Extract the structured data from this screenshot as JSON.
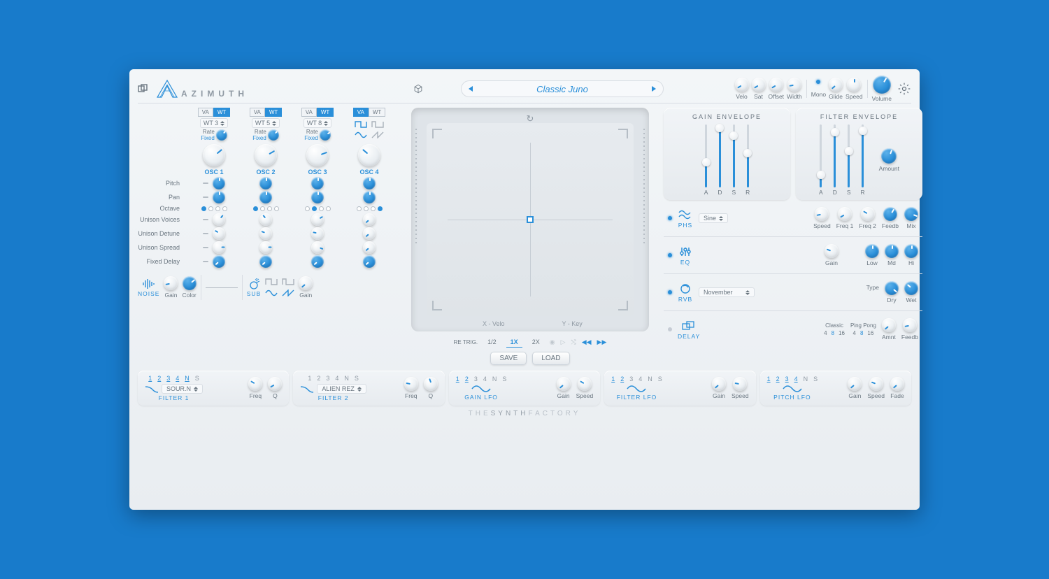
{
  "brand": "AZIMUTH",
  "topknobs": {
    "velo": "Velo",
    "sat": "Sat",
    "offset": "Offset",
    "width": "Width",
    "mono": "Mono",
    "glide": "Glide",
    "speed": "Speed",
    "volume": "Volume"
  },
  "preset": {
    "name": "Classic Juno"
  },
  "osc": {
    "tab_va": "VA",
    "tab_wt": "WT",
    "wt": [
      "WT 3",
      "WT 5",
      "WT 8"
    ],
    "rate": "Rate",
    "fixed": "Fixed",
    "labels": [
      "OSC 1",
      "OSC 2",
      "OSC 3",
      "OSC 4"
    ],
    "rows": {
      "pitch": "Pitch",
      "pan": "Pan",
      "octave": "Octave",
      "uvoices": "Unison Voices",
      "udetune": "Unison Detune",
      "uspread": "Unison Spread",
      "fdelay": "Fixed Delay"
    }
  },
  "noise": {
    "label": "NOISE",
    "gain": "Gain",
    "color": "Color"
  },
  "sub": {
    "label": "SUB",
    "gain": "Gain"
  },
  "xy": {
    "x": "X - Velo",
    "y": "Y - Key",
    "retrig": "RE TRIG.",
    "half": "1/2",
    "one": "1X",
    "two": "2X",
    "save": "SAVE",
    "load": "LOAD"
  },
  "env": {
    "gain_title": "GAIN ENVELOPE",
    "filter_title": "FILTER ENVELOPE",
    "a": "A",
    "d": "D",
    "s": "S",
    "r": "R",
    "amount": "Amount",
    "gain_vals": {
      "a": 40,
      "d": 95,
      "s": 82,
      "r": 55
    },
    "filter_vals": {
      "a": 20,
      "d": 88,
      "s": 58,
      "r": 90
    }
  },
  "fx": {
    "phs": {
      "name": "PHS",
      "shape": "Sine",
      "speed": "Speed",
      "f1": "Freq 1",
      "f2": "Freq 2",
      "fb": "Feedb",
      "mix": "Mix"
    },
    "eq": {
      "name": "EQ",
      "gain": "Gain",
      "low": "Low",
      "md": "Md",
      "hi": "Hi"
    },
    "rvb": {
      "name": "RVB",
      "preset": "November",
      "type": "Type",
      "dry": "Dry",
      "wet": "Wet"
    },
    "delay": {
      "name": "DELAY",
      "classic": "Classic",
      "pingpong": "Ping Pong",
      "d4": "4",
      "d8": "8",
      "d16": "16",
      "amnt": "Amnt",
      "fb": "Feedb"
    }
  },
  "filters": {
    "f1": {
      "name": "FILTER 1",
      "preset": "SOUR.N",
      "freq": "Freq",
      "q": "Q"
    },
    "f2": {
      "name": "FILTER 2",
      "preset": "ALIEN REZ",
      "freq": "Freq",
      "q": "Q"
    },
    "nums": {
      "n1": "1",
      "n2": "2",
      "n3": "3",
      "n4": "4",
      "nN": "N",
      "nS": "S"
    }
  },
  "lfo": {
    "gain": {
      "name": "GAIN LFO",
      "gain": "Gain",
      "speed": "Speed"
    },
    "filter": {
      "name": "FILTER LFO",
      "gain": "Gain",
      "speed": "Speed"
    },
    "pitch": {
      "name": "PITCH LFO",
      "gain": "Gain",
      "speed": "Speed",
      "fade": "Fade"
    }
  },
  "footer": {
    "pre": "THE",
    "mid": "SYNTH",
    "post": "FACTORY"
  }
}
